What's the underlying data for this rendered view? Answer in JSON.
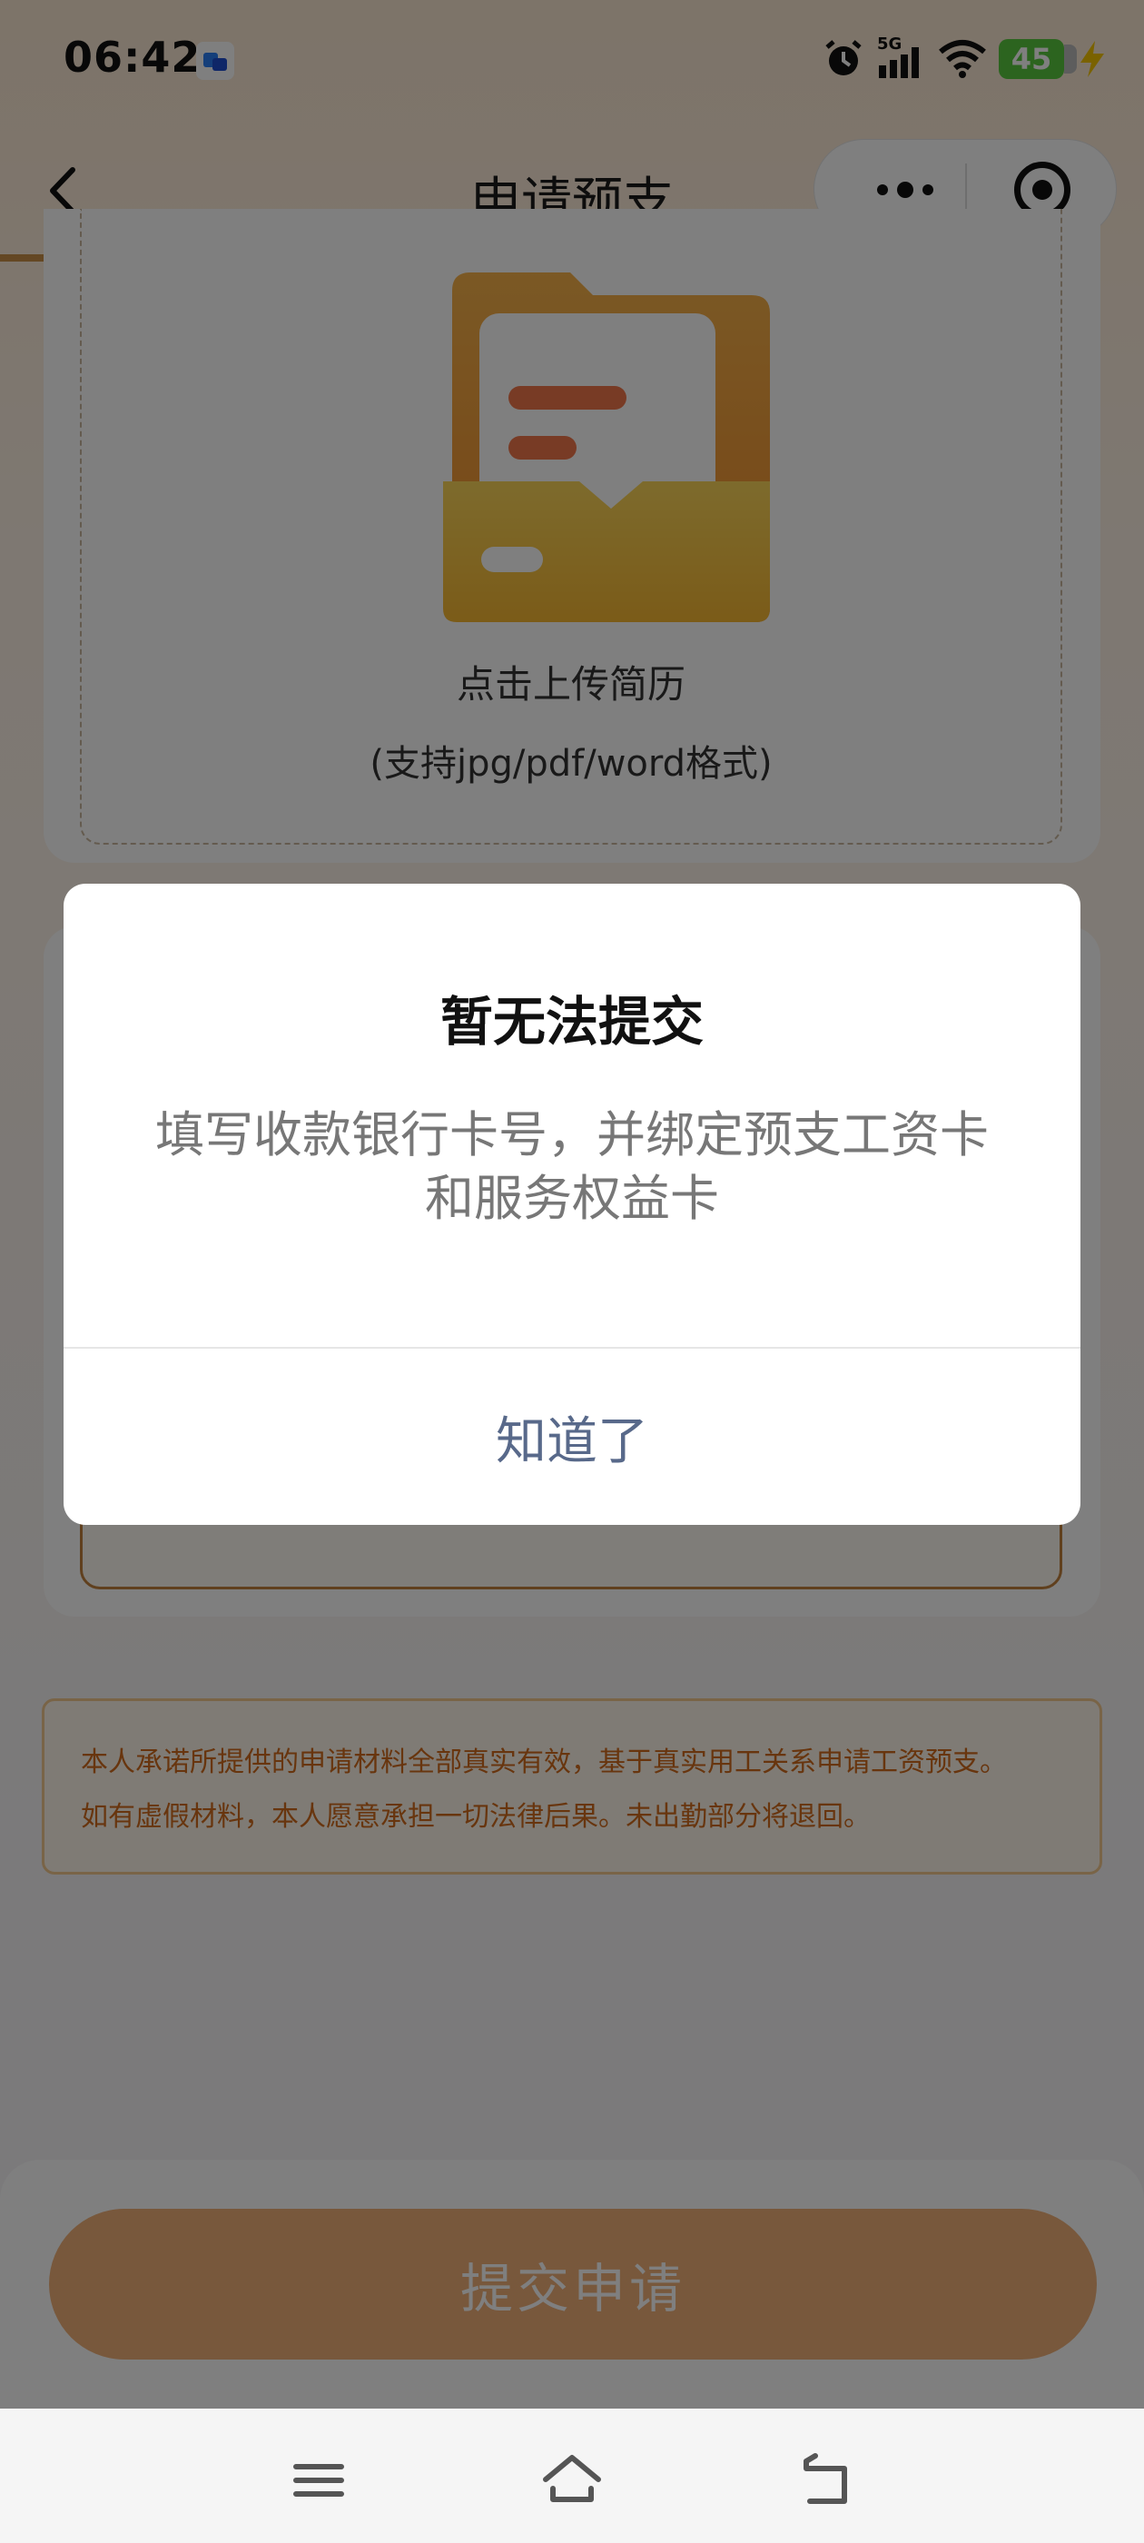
{
  "status_bar": {
    "time": "06:42",
    "network": "5G",
    "battery": "45"
  },
  "nav": {
    "title": "申请预支"
  },
  "upload": {
    "label": "点击上传简历",
    "hint": "(支持jpg/pdf/word格式)"
  },
  "notice": {
    "line1": "本人承诺所提供的申请材料全部真实有效，基于真实用工关系申请工资预支。",
    "line2": "如有虚假材料，本人愿意承担一切法律后果。未出勤部分将退回。"
  },
  "submit": {
    "label": "提交申请"
  },
  "dialog": {
    "title": "暂无法提交",
    "message": "填写收款银行卡号，并绑定预支工资卡和服务权益卡",
    "confirm_label": "知道了"
  },
  "colors": {
    "accent": "#c98f46",
    "notice_text": "#d06a1d",
    "submit_bg": "#f0b078",
    "dialog_button": "#58698a"
  }
}
